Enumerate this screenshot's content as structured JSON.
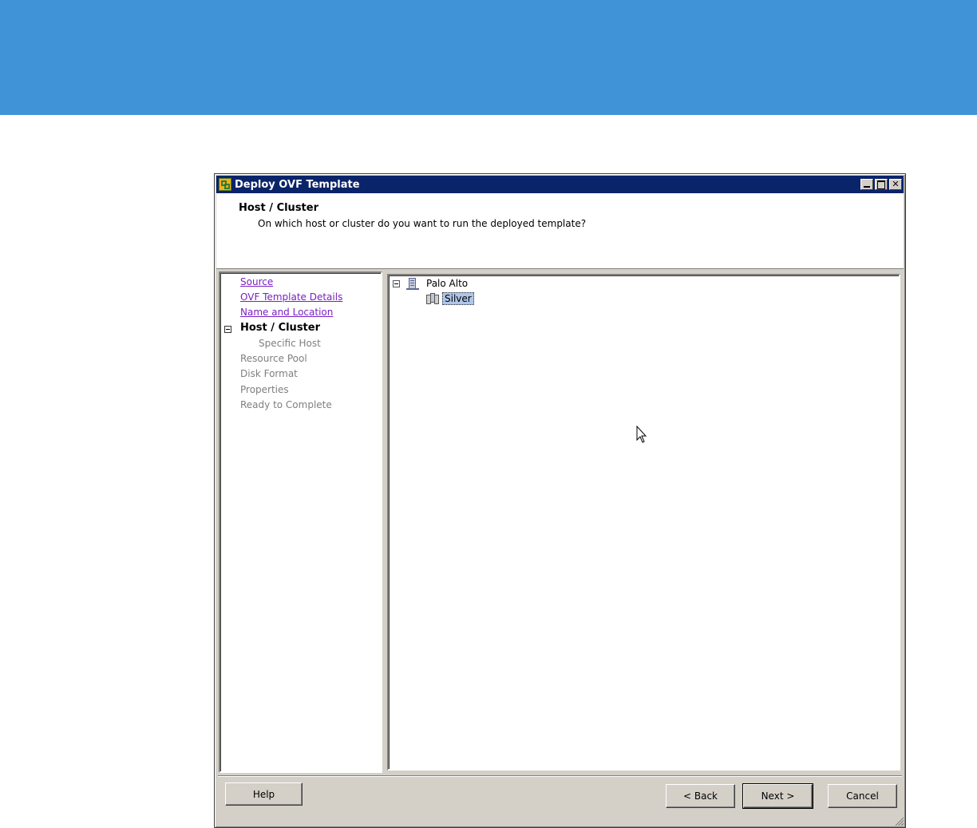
{
  "window": {
    "title": "Deploy OVF Template",
    "buttons": [
      "minimize",
      "maximize",
      "close"
    ]
  },
  "header": {
    "title": "Host / Cluster",
    "subtitle": "On which host or cluster do you want to run the deployed template?"
  },
  "steps": {
    "completed": [
      {
        "label": "Source"
      },
      {
        "label": "OVF Template Details"
      },
      {
        "label": "Name and Location"
      }
    ],
    "current": {
      "label": "Host / Cluster"
    },
    "sub": {
      "label": "Specific Host"
    },
    "pending": [
      {
        "label": "Resource Pool"
      },
      {
        "label": "Disk Format"
      },
      {
        "label": "Properties"
      },
      {
        "label": "Ready to Complete"
      }
    ]
  },
  "tree": {
    "datacenter": {
      "label": "Palo Alto",
      "icon": "datacenter-icon",
      "expanded": true
    },
    "cluster": {
      "label": "Silver",
      "icon": "cluster-icon",
      "selected": true
    }
  },
  "footer": {
    "help_label": "Help",
    "back_label": "< Back",
    "next_label": "Next >",
    "cancel_label": "Cancel"
  },
  "colors": {
    "banner": "#4193d7",
    "titlebar": "#0a246a",
    "dialog_face": "#d4d0c8",
    "visited_link": "#7a1fc4",
    "selection": "#aec6e8"
  }
}
